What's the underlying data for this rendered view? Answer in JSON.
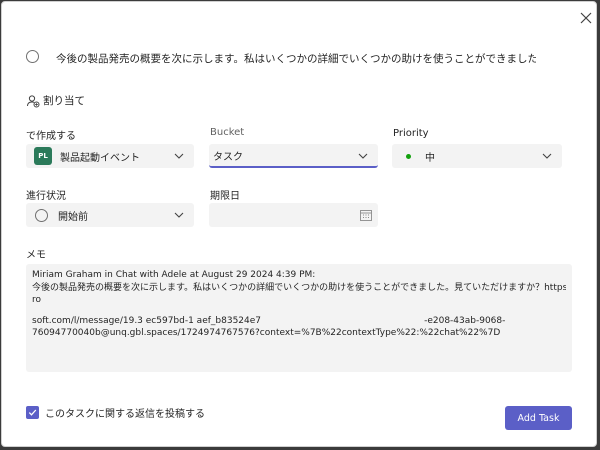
{
  "dialog": {
    "title_text": "今後の製品発売の概要を次に示します。私はいくつかの詳細でいくつかの助けを使うことができました。y...",
    "assign_label": "割り当て",
    "plan": {
      "label": "で作成する",
      "badge": "PL",
      "value": "製品起動イベント"
    },
    "bucket": {
      "label": "Bucket",
      "value": "タスク"
    },
    "priority": {
      "label": "Priority",
      "value": "中",
      "color": "#13a10e"
    },
    "progress": {
      "label": "進行状況",
      "value": "開始前"
    },
    "due": {
      "label": "期限日",
      "value": ""
    },
    "notes": {
      "label": "メモ",
      "line1": "Miriam Graham in Chat with Adele at August 29 2024 4:39 PM:",
      "line2": "今後の製品発売の概要を次に示します。私はいくつかの詳細でいくつかの助けを使うことができました。見ていただけますか？https://teams.mic",
      "line3": "ro",
      "line4a": "soft.com/l/message/19.3 ec597bd-1 aef_b83524e7",
      "line4b": "-e208-43ab-9068-",
      "line5": "76094770040b@unq.gbl.spaces/1724974767576?context=%7B%22contextType%22:%22chat%22%7D"
    },
    "post_reply_label": "このタスクに関する返信を投稿する",
    "add_button": "Add Task"
  }
}
